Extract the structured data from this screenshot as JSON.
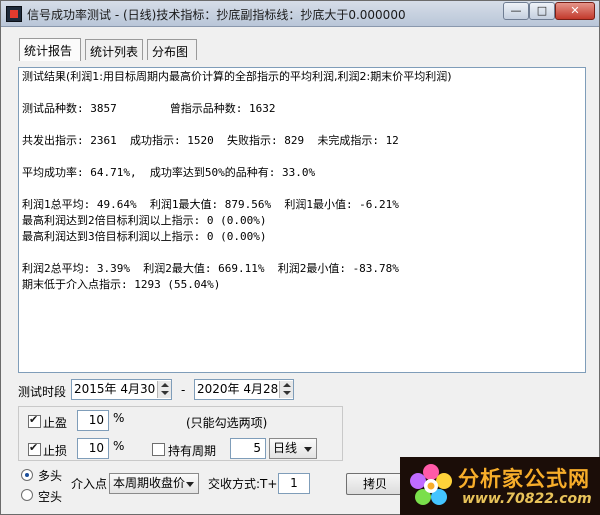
{
  "window": {
    "title": "信号成功率测试 - (日线)技术指标：抄底副指标线：抄底大于0.000000",
    "buttons": {
      "minimize": "—",
      "maximize": "□",
      "close": "✕"
    }
  },
  "tabs": [
    {
      "label": "统计报告",
      "active": true
    },
    {
      "label": "统计列表",
      "active": false
    },
    {
      "label": "分布图",
      "active": false
    }
  ],
  "report": {
    "lines": [
      "测试结果(利润1:用目标周期内最高价计算的全部指示的平均利润,利润2:期末价平均利润)",
      "",
      "测试品种数: 3857        曾指示品种数: 1632",
      "",
      "共发出指示: 2361  成功指示: 1520  失败指示: 829  未完成指示: 12",
      "",
      "平均成功率: 64.71%,  成功率达到50%的品种有: 33.0%",
      "",
      "利润1总平均: 49.64%  利润1最大值: 879.56%  利润1最小值: -6.21%",
      "最高利润达到2倍目标利润以上指示: 0 (0.00%)",
      "最高利润达到3倍目标利润以上指示: 0 (0.00%)",
      "",
      "利润2总平均: 3.39%  利润2最大值: 669.11%  利润2最小值: -83.78%",
      "期末低于介入点指示: 1293 (55.04%)"
    ]
  },
  "period": {
    "label": "测试时段",
    "start": "2015年 4月30日",
    "separator": "-",
    "end": "2020年 4月28日"
  },
  "settings": {
    "take_profit": {
      "label": "止盈",
      "checked": true,
      "value": "10",
      "unit": "%"
    },
    "hint": "(只能勾选两项)",
    "stop_loss": {
      "label": "止损",
      "checked": true,
      "value": "10",
      "unit": "%"
    },
    "hold_period": {
      "label": "持有周期",
      "checked": false,
      "value": "5",
      "unit_select": "日线"
    }
  },
  "direction": {
    "long": {
      "label": "多头",
      "selected": true
    },
    "short": {
      "label": "空头",
      "selected": false
    }
  },
  "entry": {
    "label": "介入点",
    "select": "本周期收盘价",
    "trade_label": "交收方式:T+",
    "trade_value": "1"
  },
  "buttons": {
    "copy": "拷贝"
  },
  "watermark": {
    "name": "分析家公式网",
    "url": "www.70822.com"
  },
  "colors": {
    "watermark_bg": "#1b0d08",
    "watermark_text": "#f7ad2a"
  }
}
